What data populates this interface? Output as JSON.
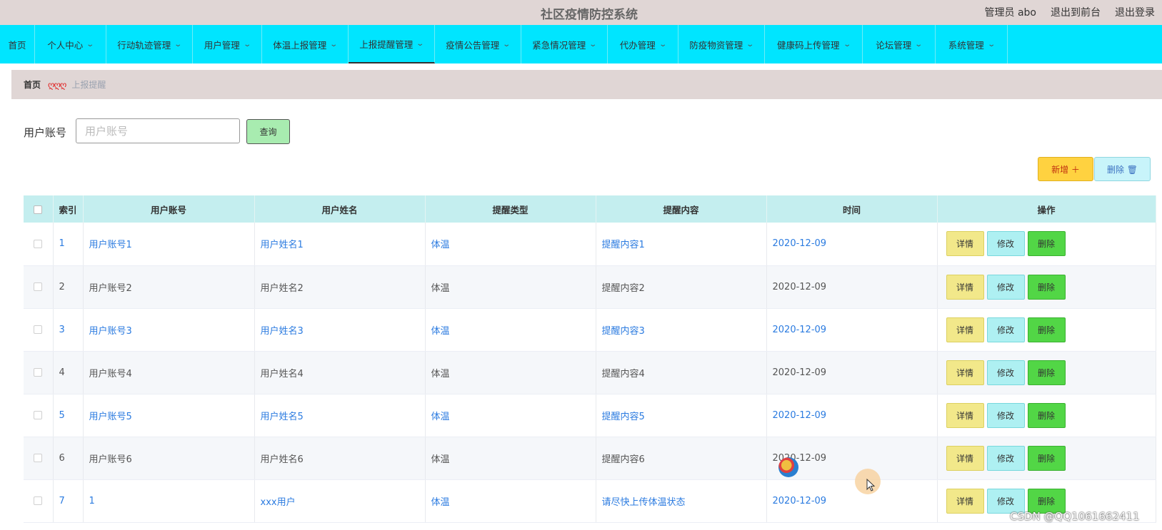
{
  "header": {
    "title": "社区疫情防控系统",
    "admin": "管理员 abo",
    "front": "退出到前台",
    "logout": "退出登录"
  },
  "nav": [
    {
      "label": "首页",
      "dropdown": false
    },
    {
      "label": "个人中心",
      "dropdown": true
    },
    {
      "label": "行动轨迹管理",
      "dropdown": true
    },
    {
      "label": "用户管理",
      "dropdown": true
    },
    {
      "label": "体温上报管理",
      "dropdown": true
    },
    {
      "label": "上报提醒管理",
      "dropdown": true,
      "active": true
    },
    {
      "label": "疫情公告管理",
      "dropdown": true
    },
    {
      "label": "紧急情况管理",
      "dropdown": true
    },
    {
      "label": "代办管理",
      "dropdown": true
    },
    {
      "label": "防疫物资管理",
      "dropdown": true
    },
    {
      "label": "健康码上传管理",
      "dropdown": true
    },
    {
      "label": "论坛管理",
      "dropdown": true
    },
    {
      "label": "系统管理",
      "dropdown": true
    }
  ],
  "breadcrumb": {
    "home": "首页",
    "separator": "ღღღ",
    "current": "上报提醒"
  },
  "search": {
    "label": "用户账号",
    "placeholder": "用户账号",
    "value": "",
    "button": "查询"
  },
  "actions": {
    "add": "新增 ＋",
    "delete": "删除 🗑"
  },
  "table": {
    "columns": [
      "索引",
      "用户账号",
      "用户姓名",
      "提醒类型",
      "提醒内容",
      "时间",
      "操作"
    ],
    "rows": [
      {
        "index": "1",
        "account": "用户账号1",
        "name": "用户姓名1",
        "type": "体温",
        "content": "提醒内容1",
        "time": "2020-12-09"
      },
      {
        "index": "2",
        "account": "用户账号2",
        "name": "用户姓名2",
        "type": "体温",
        "content": "提醒内容2",
        "time": "2020-12-09"
      },
      {
        "index": "3",
        "account": "用户账号3",
        "name": "用户姓名3",
        "type": "体温",
        "content": "提醒内容3",
        "time": "2020-12-09"
      },
      {
        "index": "4",
        "account": "用户账号4",
        "name": "用户姓名4",
        "type": "体温",
        "content": "提醒内容4",
        "time": "2020-12-09"
      },
      {
        "index": "5",
        "account": "用户账号5",
        "name": "用户姓名5",
        "type": "体温",
        "content": "提醒内容5",
        "time": "2020-12-09"
      },
      {
        "index": "6",
        "account": "用户账号6",
        "name": "用户姓名6",
        "type": "体温",
        "content": "提醒内容6",
        "time": "2020-12-09"
      },
      {
        "index": "7",
        "account": "1",
        "name": "xxx用户",
        "type": "体温",
        "content": "请尽快上传体温状态",
        "time": "2020-12-09"
      }
    ],
    "row_actions": {
      "detail": "详情",
      "edit": "修改",
      "delete": "删除"
    }
  },
  "watermark": "CSDN @QQ1061662411",
  "colors": {
    "nav_bg": "#00e5ff",
    "header_bg": "#e0d6d5",
    "link": "#2b7be0",
    "table_head": "#c4eeef"
  }
}
